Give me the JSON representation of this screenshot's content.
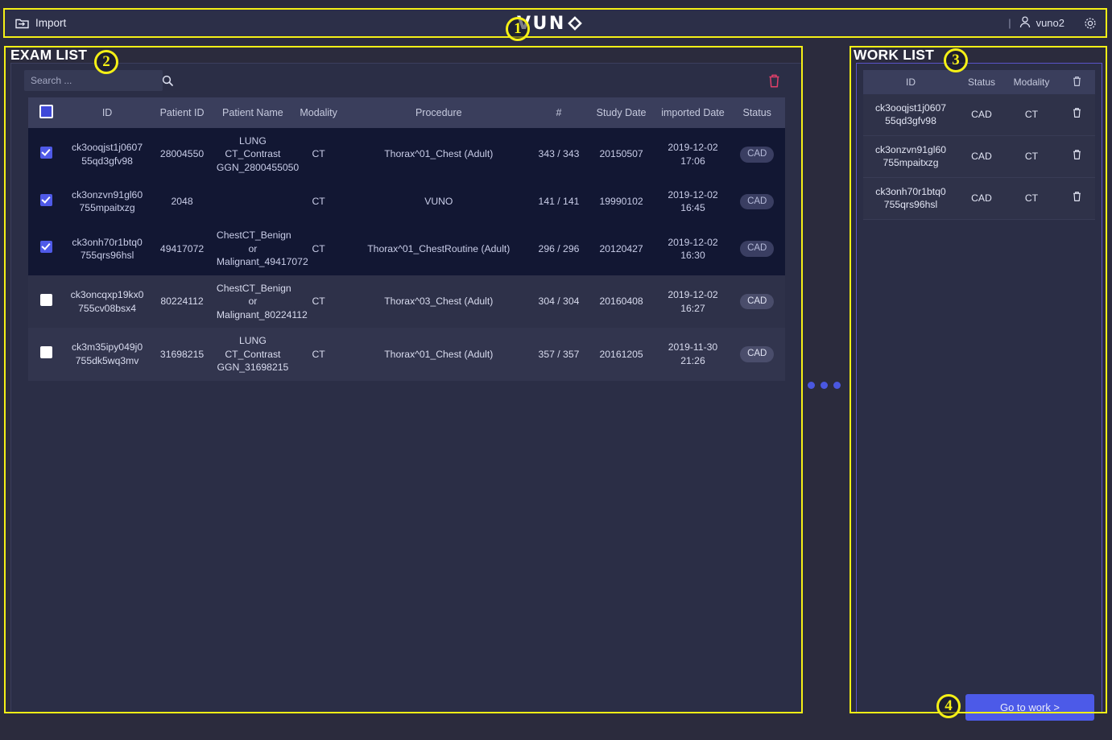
{
  "topbar": {
    "import_label": "Import",
    "brand": "VUNO",
    "divider": "|",
    "user": "vuno2",
    "icons": {
      "folder": "folder-import-icon",
      "user": "user-icon",
      "gear": "gear-icon"
    }
  },
  "exam_panel": {
    "title": "EXAM LIST",
    "search_placeholder": "Search ...",
    "search_value": "",
    "columns": [
      "",
      "ID",
      "Patient ID",
      "Patient Name",
      "Modality",
      "Procedure",
      "#",
      "Study Date",
      "imported Date",
      "Status"
    ],
    "rows": [
      {
        "selected": true,
        "id": "ck3ooqjst1j0607 55qd3gfv98",
        "patient_id": "28004550",
        "patient_name": "LUNG CT_Contrast GGN_2800455050",
        "modality": "CT",
        "procedure": "Thorax^01_Chest (Adult)",
        "count": "343 / 343",
        "study_date": "20150507",
        "imported_date": "2019-12-02 17:06",
        "status": "CAD"
      },
      {
        "selected": true,
        "id": "ck3onzvn91gl60 755mpaitxzg",
        "patient_id": "2048",
        "patient_name": "",
        "modality": "CT",
        "procedure": "VUNO",
        "count": "141 / 141",
        "study_date": "19990102",
        "imported_date": "2019-12-02 16:45",
        "status": "CAD"
      },
      {
        "selected": true,
        "id": "ck3onh70r1btq0 755qrs96hsl",
        "patient_id": "49417072",
        "patient_name": "ChestCT_Benign or Malignant_49417072",
        "modality": "CT",
        "procedure": "Thorax^01_ChestRoutine (Adult)",
        "count": "296 / 296",
        "study_date": "20120427",
        "imported_date": "2019-12-02 16:30",
        "status": "CAD"
      },
      {
        "selected": false,
        "id": "ck3oncqxp19kx0 755cv08bsx4",
        "patient_id": "80224112",
        "patient_name": "ChestCT_Benign or Malignant_80224112",
        "modality": "CT",
        "procedure": "Thorax^03_Chest (Adult)",
        "count": "304 / 304",
        "study_date": "20160408",
        "imported_date": "2019-12-02 16:27",
        "status": "CAD"
      },
      {
        "selected": false,
        "id": "ck3m35ipy049j0 755dk5wq3mv",
        "patient_id": "31698215",
        "patient_name": "LUNG CT_Contrast GGN_31698215",
        "modality": "CT",
        "procedure": "Thorax^01_Chest (Adult)",
        "count": "357 / 357",
        "study_date": "20161205",
        "imported_date": "2019-11-30 21:26",
        "status": "CAD"
      }
    ]
  },
  "work_panel": {
    "title": "WORK LIST",
    "columns": [
      "ID",
      "Status",
      "Modality",
      ""
    ],
    "rows": [
      {
        "id": "ck3ooqjst1j0607 55qd3gfv98",
        "status": "CAD",
        "modality": "CT"
      },
      {
        "id": "ck3onzvn91gl60 755mpaitxzg",
        "status": "CAD",
        "modality": "CT"
      },
      {
        "id": "ck3onh70r1btq0 755qrs96hsl",
        "status": "CAD",
        "modality": "CT"
      }
    ],
    "goto_label": "Go to work >"
  },
  "annotations": {
    "one": "1",
    "two": "2",
    "three": "3",
    "four": "4"
  },
  "colors": {
    "accent": "#4c5ae8",
    "annotation": "#f5f016",
    "panel_bg": "#2b2e46",
    "selected_row": "#121733",
    "work_border": "#5a53c7",
    "trash_red": "#e0406a"
  }
}
